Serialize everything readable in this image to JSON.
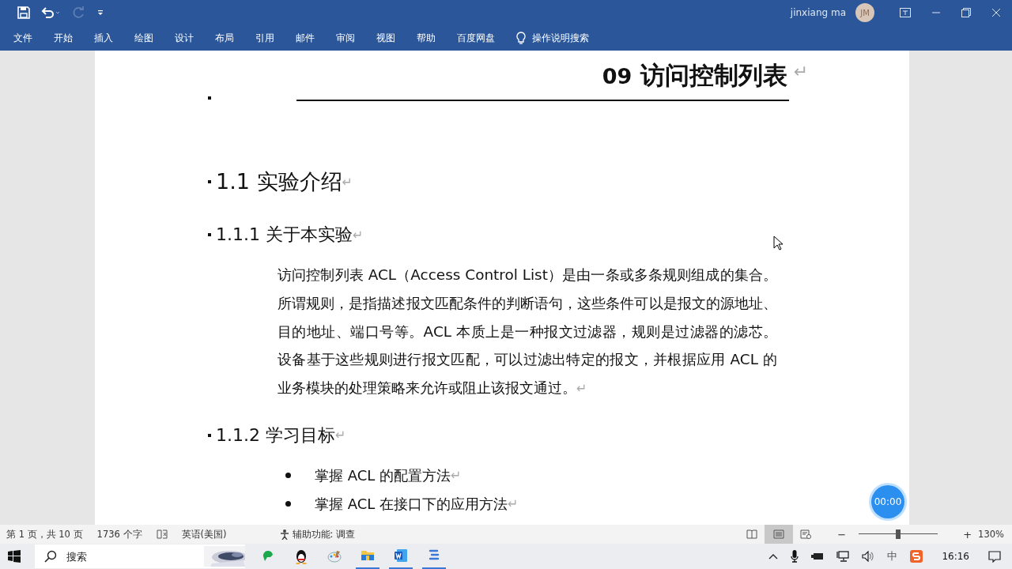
{
  "title_bar": {
    "user_name": "jinxiang ma",
    "avatar_initials": "JM"
  },
  "ribbon_tabs": [
    {
      "label": "文件",
      "selected": false
    },
    {
      "label": "开始",
      "selected": false
    },
    {
      "label": "插入",
      "selected": false
    },
    {
      "label": "绘图",
      "selected": false
    },
    {
      "label": "设计",
      "selected": false
    },
    {
      "label": "布局",
      "selected": false
    },
    {
      "label": "引用",
      "selected": false
    },
    {
      "label": "邮件",
      "selected": false
    },
    {
      "label": "审阅",
      "selected": false
    },
    {
      "label": "视图",
      "selected": false
    },
    {
      "label": "帮助",
      "selected": false
    },
    {
      "label": "百度网盘",
      "selected": false
    }
  ],
  "tell_me": {
    "placeholder": "操作说明搜索"
  },
  "document": {
    "title": {
      "number": "09",
      "text": "访问控制列表",
      "mark": "↵"
    },
    "blocks": [
      {
        "kind": "heading1",
        "text": "1.1 实验介绍",
        "mark": "↵"
      },
      {
        "kind": "heading2",
        "text": "1.1.1 关于本实验",
        "mark": "↵"
      },
      {
        "kind": "paragraph",
        "text": "访问控制列表 ACL（Access Control List）是由一条或多条规则组成的集合。所谓规则，是指描述报文匹配条件的判断语句，这些条件可以是报文的源地址、目的地址、端口号等。ACL 本质上是一种报文过滤器，规则是过滤器的滤芯。设备基于这些规则进行报文匹配，可以过滤出特定的报文，并根据应用 ACL 的业务模块的处理策略来允许或阻止该报文通过。",
        "mark": "↵"
      },
      {
        "kind": "heading2",
        "text": "1.1.2 学习目标",
        "mark": "↵"
      },
      {
        "kind": "bullet",
        "text": "掌握 ACL 的配置方法",
        "mark": "↵"
      },
      {
        "kind": "bullet",
        "text": "掌握 ACL 在接口下的应用方法",
        "mark": "↵"
      }
    ]
  },
  "recorder_timer": "00:00",
  "status_bar": {
    "page": "第 1 页，共 10 页",
    "words": "1736 个字",
    "language": "英语(美国)",
    "accessibility": "辅助功能: 调查",
    "views": [
      {
        "kind": "read",
        "selected": false
      },
      {
        "kind": "print",
        "selected": true
      },
      {
        "kind": "web",
        "selected": false
      }
    ],
    "zoom_minus": "−",
    "zoom_plus": "+",
    "zoom": {
      "level": 0.5
    },
    "zoom_percent": "130%"
  },
  "taskbar": {
    "search": {
      "placeholder": "搜索"
    },
    "apps": [
      {
        "kind": "green",
        "active": false
      },
      {
        "kind": "penguin",
        "active": false
      },
      {
        "kind": "paint",
        "active": false
      },
      {
        "kind": "folder",
        "active": true
      },
      {
        "kind": "word",
        "active": true
      },
      {
        "kind": "tool",
        "active": true
      }
    ],
    "ime": "中",
    "time": "16:16"
  }
}
